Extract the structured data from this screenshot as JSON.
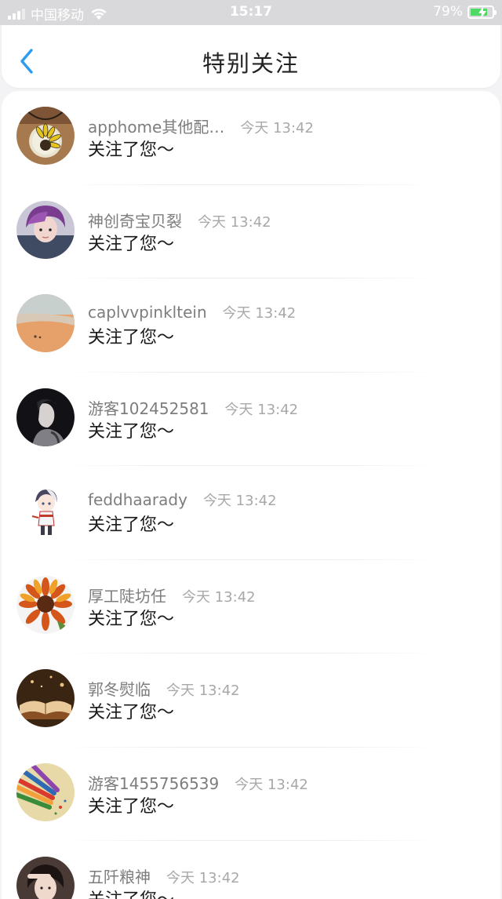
{
  "status_bar": {
    "carrier": "中国移动",
    "time": "15:17",
    "battery": "79%",
    "battery_level": 0.79
  },
  "nav": {
    "title": "特别关注",
    "back_icon": "chevron-left-icon",
    "accent": "#2d9cf0"
  },
  "items": [
    {
      "name": "apphome其他配…",
      "time": "今天 13:42",
      "message": "关注了您～",
      "avatar": "pendant"
    },
    {
      "name": "神创奇宝贝裂",
      "time": "今天 13:42",
      "message": "关注了您～",
      "avatar": "purple-hair-person"
    },
    {
      "name": "caplvvpinkltein",
      "time": "今天 13:42",
      "message": "关注了您～",
      "avatar": "beach"
    },
    {
      "name": "游客102452581",
      "time": "今天 13:42",
      "message": "关注了您～",
      "avatar": "dark-portrait"
    },
    {
      "name": "feddhaarady",
      "time": "今天 13:42",
      "message": "关注了您～",
      "avatar": "anime-character"
    },
    {
      "name": "厚工陡坊任",
      "time": "今天 13:42",
      "message": "关注了您～",
      "avatar": "sunflower"
    },
    {
      "name": "郭冬熨临",
      "time": "今天 13:42",
      "message": "关注了您～",
      "avatar": "open-book"
    },
    {
      "name": "游客1455756539",
      "time": "今天 13:42",
      "message": "关注了您～",
      "avatar": "colored-pencils"
    },
    {
      "name": "五阡粮神",
      "time": "今天 13:42",
      "message": "关注了您～",
      "avatar": "woman-portrait"
    }
  ]
}
